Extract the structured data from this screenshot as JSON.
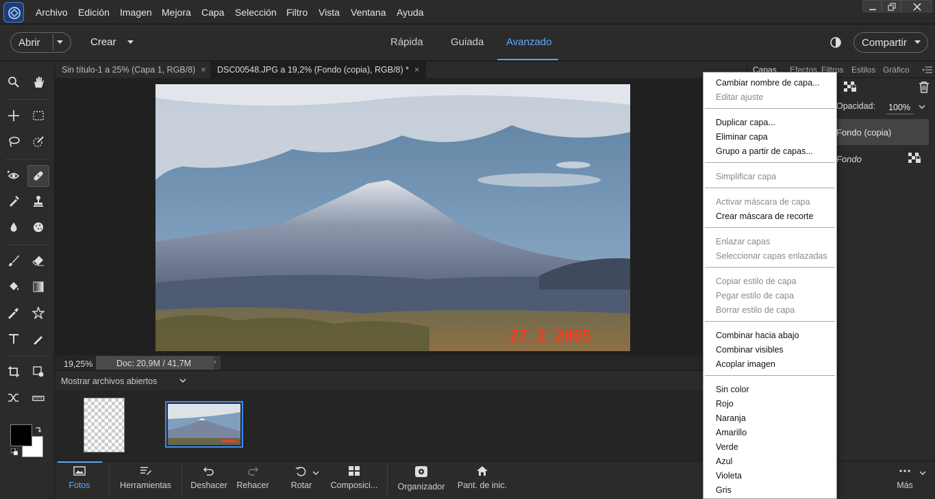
{
  "menubar": {
    "items": [
      "Archivo",
      "Edición",
      "Imagen",
      "Mejora",
      "Capa",
      "Selección",
      "Filtro",
      "Vista",
      "Ventana",
      "Ayuda"
    ],
    "window_controls": [
      "minimize-icon",
      "restore-icon",
      "close-icon"
    ]
  },
  "toolbar": {
    "open_label": "Abrir",
    "create_label": "Crear",
    "modes": [
      "Rápida",
      "Guiada",
      "Avanzado"
    ],
    "active_mode": "Avanzado",
    "share_label": "Compartir"
  },
  "doc_tabs": [
    {
      "label": "Sin título-1 a 25% (Capa 1, RGB/8)",
      "active": false
    },
    {
      "label": "DSC00548.JPG a 19,2% (Fondo (copia), RGB/8) *",
      "active": true
    }
  ],
  "photo": {
    "date_stamp": "27  2 2005"
  },
  "status": {
    "zoom": "19,25%",
    "doc_info": "Doc: 20,9M / 41,7M"
  },
  "bin": {
    "dropdown_label": "Mostrar archivos abiertos"
  },
  "bottom_bar": {
    "items": [
      "Fotos",
      "Herramientas",
      "Deshacer",
      "Rehacer",
      "Rotar",
      "Composici...",
      "Organizador",
      "Pant. de inic."
    ],
    "more_label": "Más"
  },
  "right_panel": {
    "tabs": [
      "Capas",
      "Efectos",
      "Filtros",
      "Estilos",
      "Gráficos"
    ],
    "opacity_label": "Opacidad:",
    "opacity_value": "100%",
    "layers": [
      {
        "name": "Fondo (copia)",
        "selected": true
      },
      {
        "name": "Fondo",
        "selected": false
      }
    ]
  },
  "context_menu": {
    "items": [
      {
        "label": "Cambiar nombre de capa...",
        "enabled": true
      },
      {
        "label": "Editar ajuste",
        "enabled": false
      },
      {
        "label": "Duplicar capa...",
        "enabled": true
      },
      {
        "label": "Eliminar capa",
        "enabled": true
      },
      {
        "label": "Grupo a partir de capas...",
        "enabled": true
      },
      {
        "label": "Simplificar capa",
        "enabled": false
      },
      {
        "label": "Activar máscara de capa",
        "enabled": false
      },
      {
        "label": "Crear máscara de recorte",
        "enabled": true
      },
      {
        "label": "Enlazar capas",
        "enabled": false
      },
      {
        "label": "Seleccionar capas enlazadas",
        "enabled": false
      },
      {
        "label": "Copiar estilo de capa",
        "enabled": false
      },
      {
        "label": "Pegar estilo de capa",
        "enabled": false
      },
      {
        "label": "Borrar estilo de capa",
        "enabled": false
      },
      {
        "label": "Combinar hacia abajo",
        "enabled": true
      },
      {
        "label": "Combinar visibles",
        "enabled": true
      },
      {
        "label": "Acoplar imagen",
        "enabled": true
      },
      {
        "label": "Sin color",
        "enabled": true
      },
      {
        "label": "Rojo",
        "enabled": true
      },
      {
        "label": "Naranja",
        "enabled": true
      },
      {
        "label": "Amarillo",
        "enabled": true
      },
      {
        "label": "Verde",
        "enabled": true
      },
      {
        "label": "Azul",
        "enabled": true
      },
      {
        "label": "Violeta",
        "enabled": true
      },
      {
        "label": "Gris",
        "enabled": true
      }
    ]
  },
  "colors": {
    "accent": "#5fa8ff",
    "date_stamp": "#ff3b1f",
    "foreground": "#000000",
    "background": "#ffffff"
  }
}
